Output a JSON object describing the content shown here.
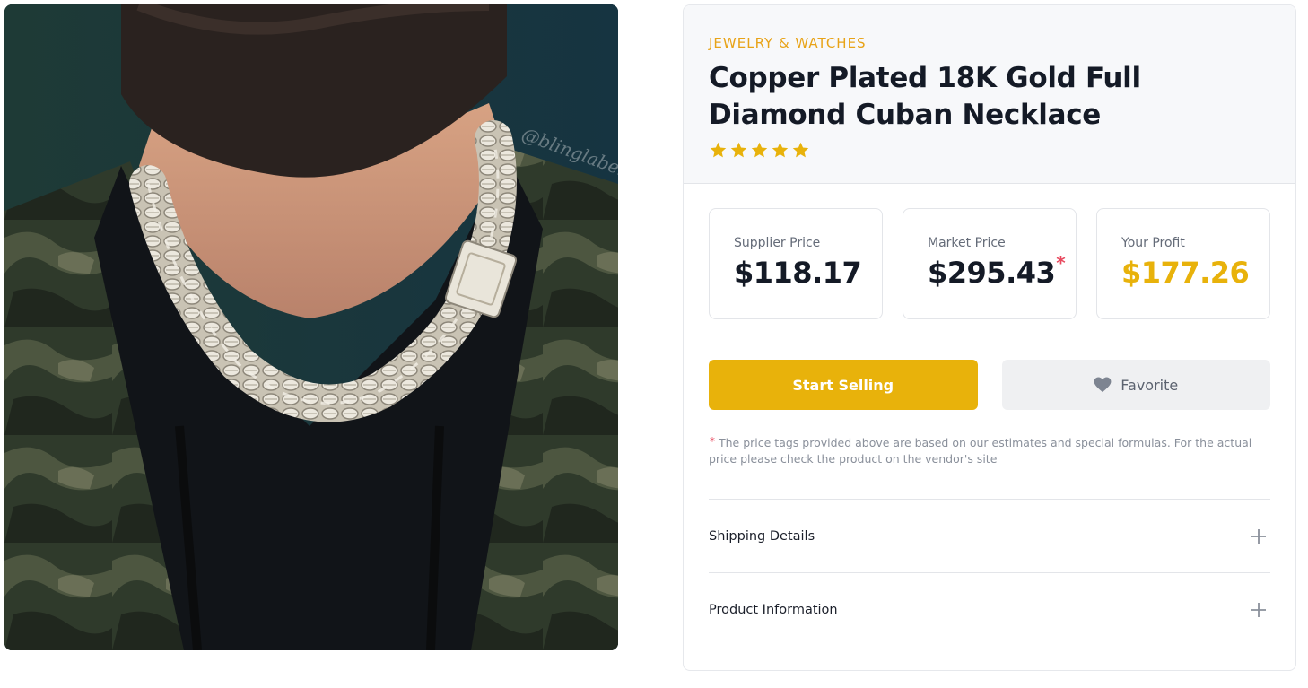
{
  "product": {
    "category": "JEWELRY & WATCHES",
    "title": "Copper Plated 18K Gold Full Diamond Cuban Necklace",
    "rating": 5,
    "photo_watermark": "@blinglabel"
  },
  "prices": {
    "supplier": {
      "label": "Supplier Price",
      "value": "$118.17"
    },
    "market": {
      "label": "Market Price",
      "value": "$295.43",
      "marker": "*"
    },
    "profit": {
      "label": "Your Profit",
      "value": "$177.26"
    }
  },
  "actions": {
    "start_selling": "Start Selling",
    "favorite": "Favorite"
  },
  "disclaimer": {
    "marker": "*",
    "text": "The price tags provided above are based on our estimates and special formulas. For the actual price please check the product on the vendor's site"
  },
  "accordion": [
    {
      "label": "Shipping Details",
      "icon": "plus-icon"
    },
    {
      "label": "Product Information",
      "icon": "plus-icon"
    }
  ],
  "colors": {
    "accent": "#e8b20b",
    "category": "#e8a317",
    "asterisk": "#e84a5f"
  }
}
